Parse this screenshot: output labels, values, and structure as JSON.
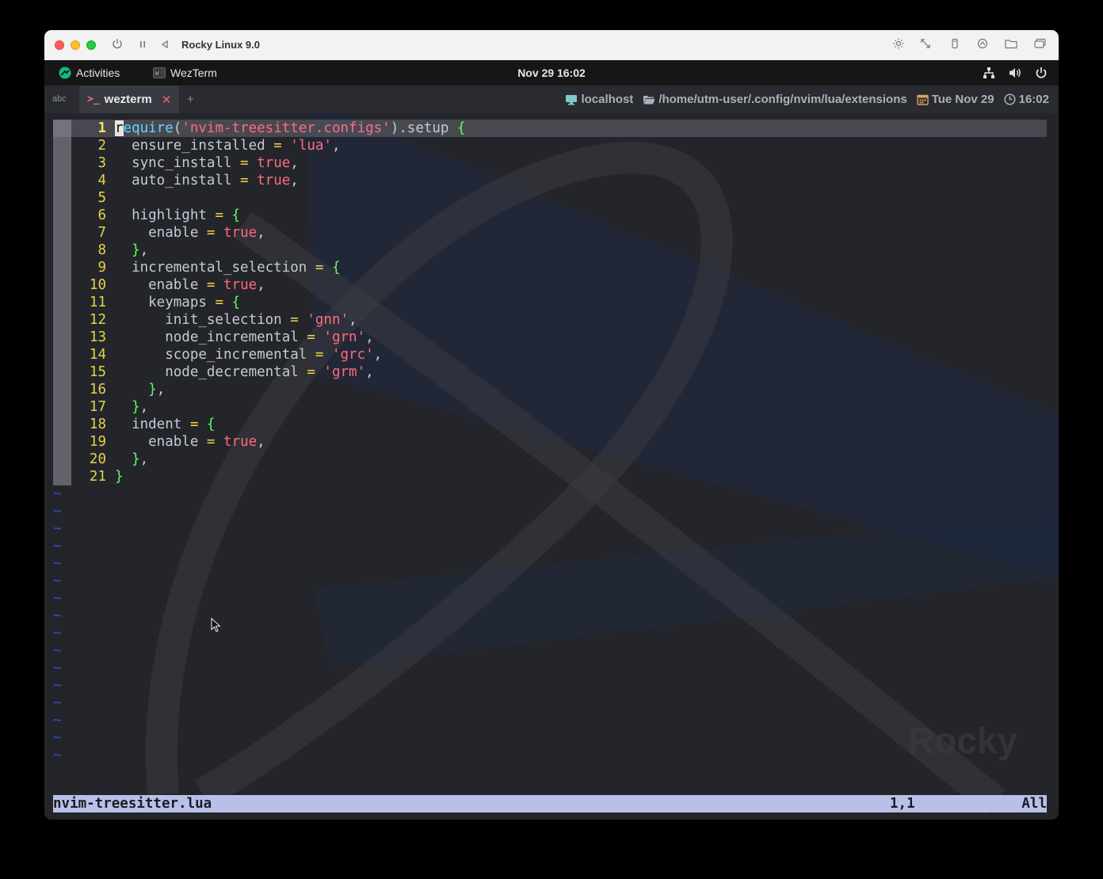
{
  "vm_window": {
    "title": "Rocky Linux 9.0",
    "toolbar_icons": [
      "power-icon",
      "pause-icon",
      "back-icon",
      "brightness-icon",
      "resize-icon",
      "usb-icon",
      "share-icon",
      "folder-icon",
      "windows-icon"
    ]
  },
  "gnome_bar": {
    "activities": "Activities",
    "app_name": "WezTerm",
    "clock": "Nov 29  16:02",
    "tray_icons": [
      "network-icon",
      "volume-icon",
      "power-icon"
    ]
  },
  "wezterm": {
    "input_mode": "abc",
    "tab_prompt": ">_",
    "tab_title": "wezterm",
    "tab_close": "✕",
    "new_tab": "+",
    "status": {
      "host": "localhost",
      "cwd": "/home/utm-user/.config/nvim/lua/extensions",
      "date": "Tue Nov 29",
      "time": "16:02"
    }
  },
  "editor": {
    "lines": [
      {
        "n": "1",
        "code": "require('nvim-treesitter.configs').setup {"
      },
      {
        "n": "2",
        "code": "  ensure_installed = 'lua',"
      },
      {
        "n": "3",
        "code": "  sync_install = true,"
      },
      {
        "n": "4",
        "code": "  auto_install = true,"
      },
      {
        "n": "5",
        "code": ""
      },
      {
        "n": "6",
        "code": "  highlight = {"
      },
      {
        "n": "7",
        "code": "    enable = true,"
      },
      {
        "n": "8",
        "code": "  },"
      },
      {
        "n": "9",
        "code": "  incremental_selection = {"
      },
      {
        "n": "10",
        "code": "    enable = true,"
      },
      {
        "n": "11",
        "code": "    keymaps = {"
      },
      {
        "n": "12",
        "code": "      init_selection = 'gnn',"
      },
      {
        "n": "13",
        "code": "      node_incremental = 'grn',"
      },
      {
        "n": "14",
        "code": "      scope_incremental = 'grc',"
      },
      {
        "n": "15",
        "code": "      node_decremental = 'grm',"
      },
      {
        "n": "16",
        "code": "    },"
      },
      {
        "n": "17",
        "code": "  },"
      },
      {
        "n": "18",
        "code": "  indent = {"
      },
      {
        "n": "19",
        "code": "    enable = true,"
      },
      {
        "n": "20",
        "code": "  },"
      },
      {
        "n": "21",
        "code": "}"
      }
    ],
    "empty_marker": "~",
    "empty_line_count": 16,
    "statusline": {
      "filename": "nvim-treesitter.lua",
      "position": "1,1",
      "scroll": "All"
    }
  },
  "colors": {
    "keyword_fn": "#5fd7ff",
    "string": "#ff6b7f",
    "operator": "#f0d64a",
    "brace": "#5fff5f",
    "line_number": "#e6d34a",
    "tilde": "#2f4fe8",
    "statusline_bg": "#b9c0e8"
  },
  "watermark_text": "Rocky"
}
